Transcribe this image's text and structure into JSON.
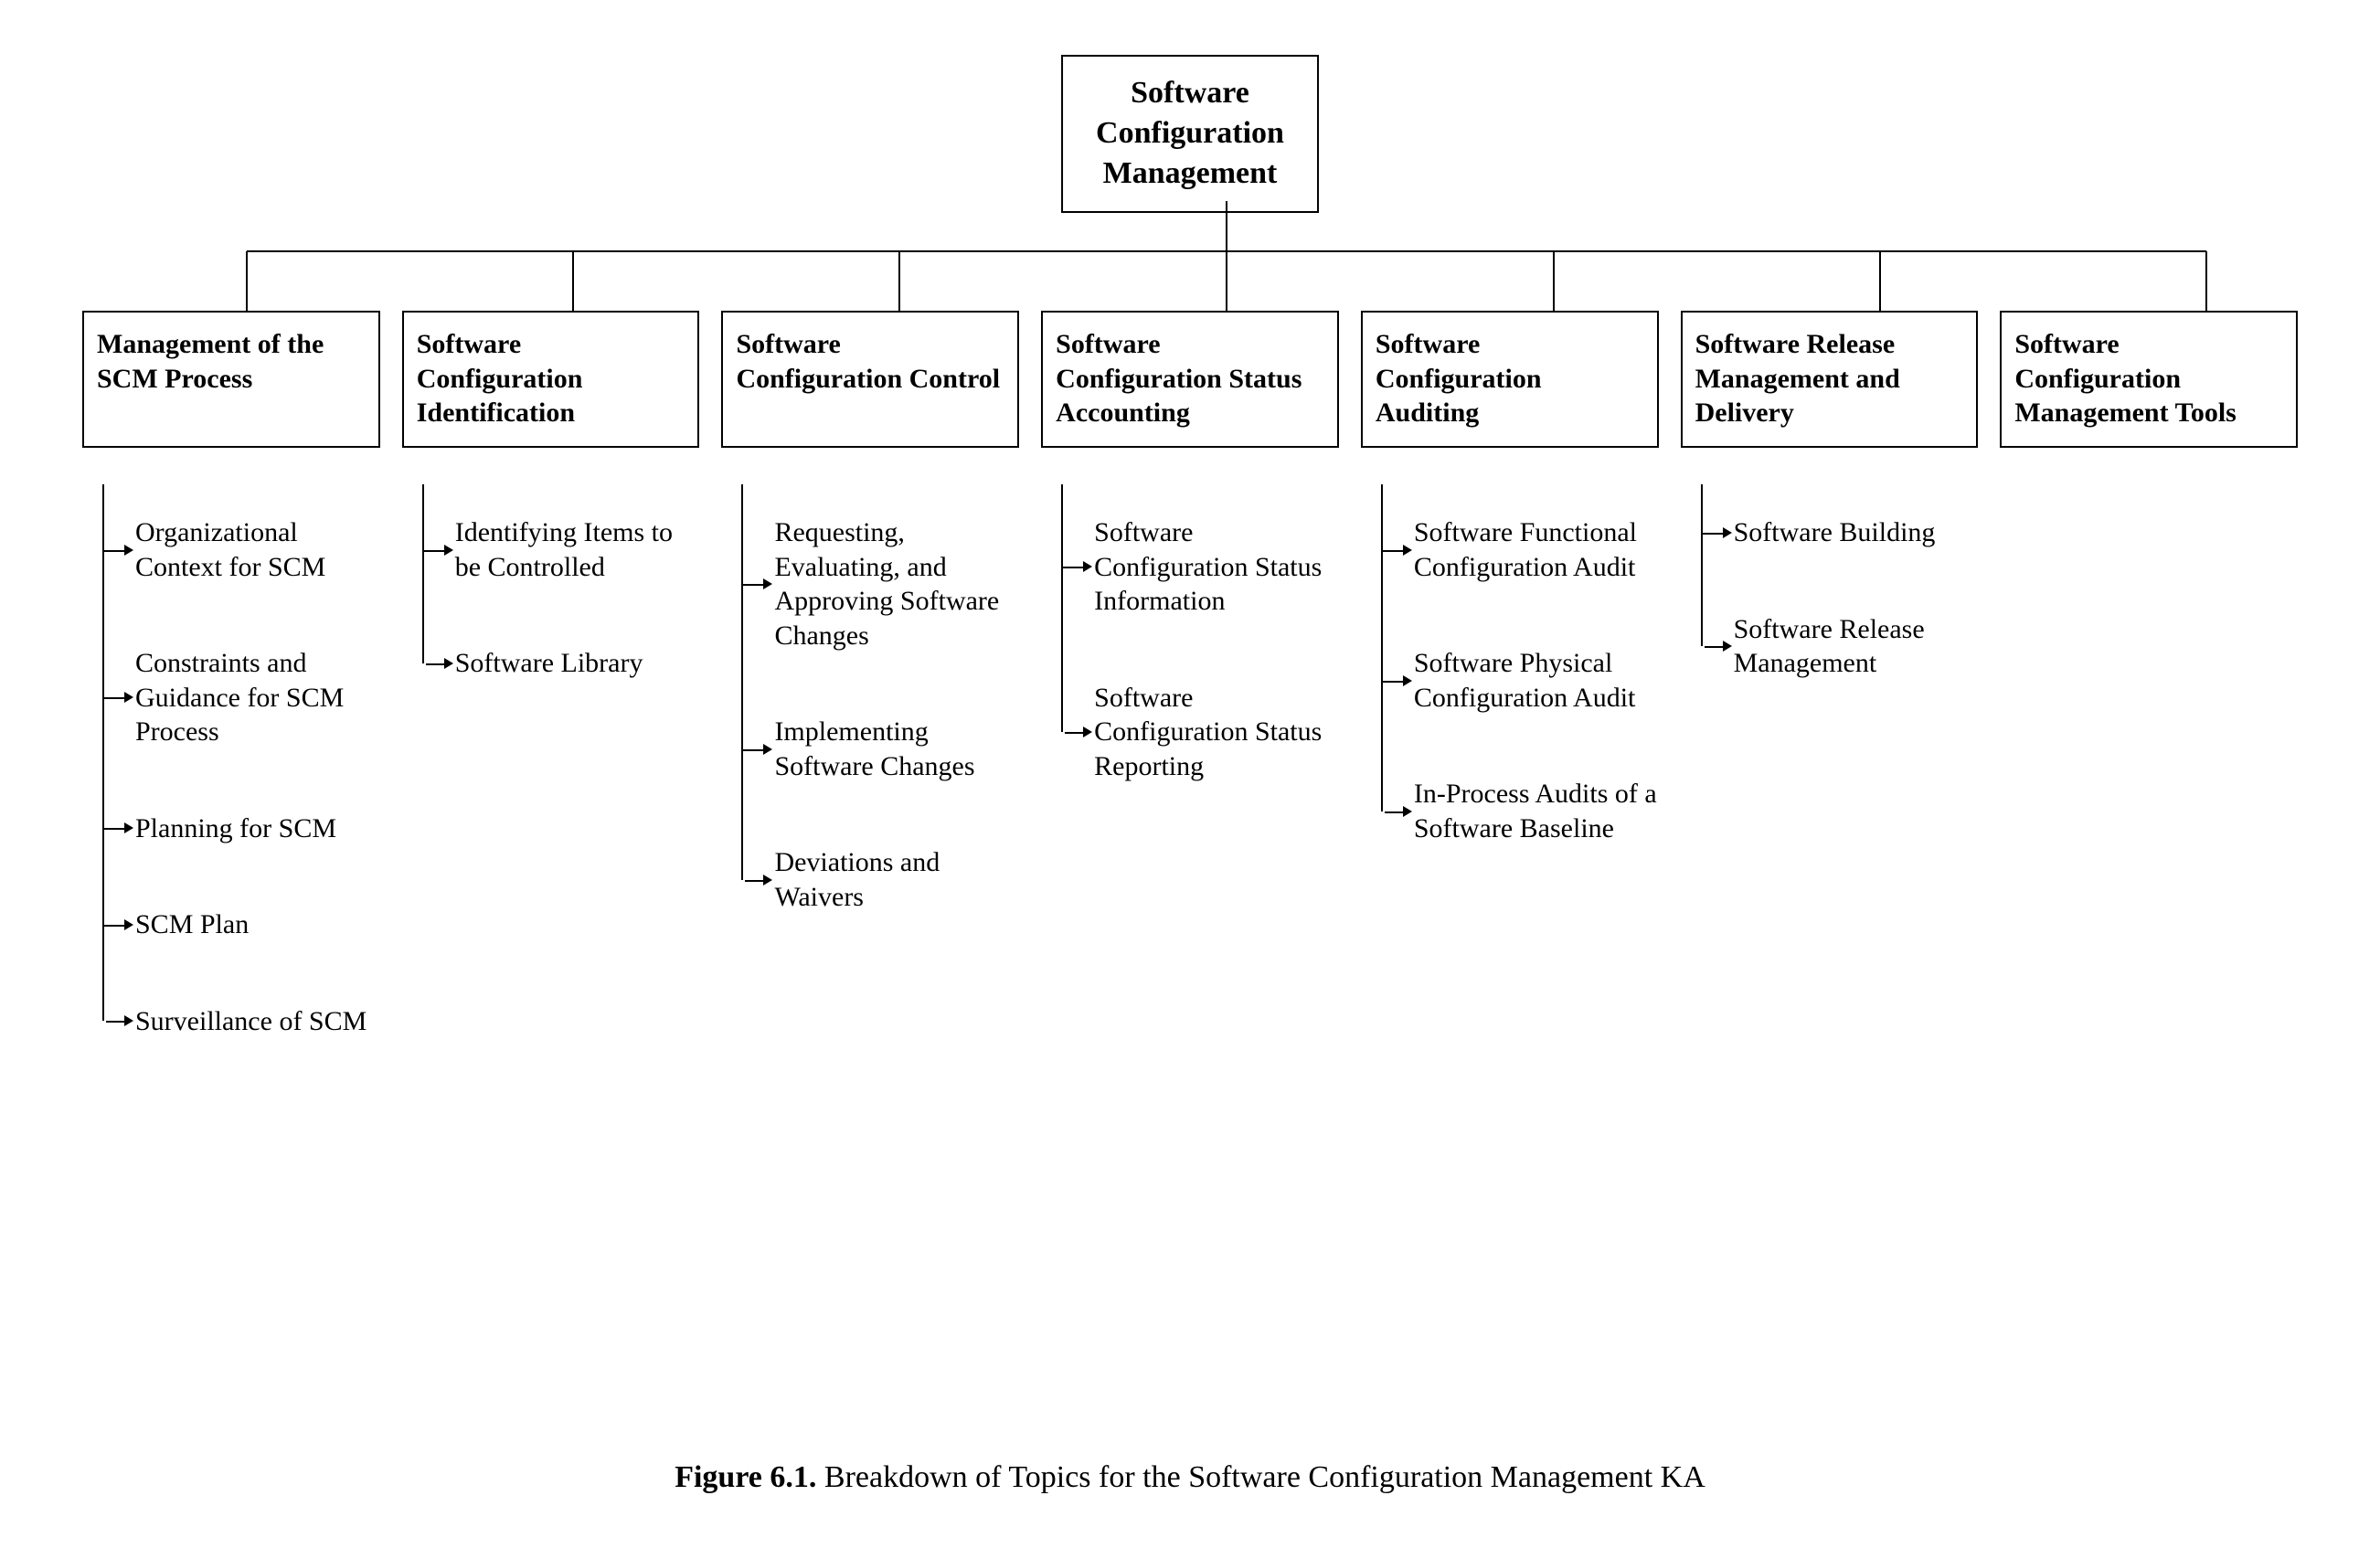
{
  "root": "Software\nConfiguration\nManagement",
  "branches": [
    {
      "label": "Management of the SCM Process",
      "subtopics": [
        "Organizational Context for SCM",
        "Constraints and Guidance for SCM Process",
        "Planning for SCM",
        "SCM Plan",
        "Surveillance of SCM"
      ]
    },
    {
      "label": "Software Configuration Identification",
      "subtopics": [
        "Identifying Items to be Controlled",
        "Software Library"
      ]
    },
    {
      "label": "Software Configuration Control",
      "subtopics": [
        "Requesting, Evaluating, and Approving Software Changes",
        "Implementing Software Changes",
        "Deviations and Waivers"
      ]
    },
    {
      "label": "Software Configuration Status Accounting",
      "subtopics": [
        "Software Configuration Status Information",
        "Software Configuration Status Reporting"
      ]
    },
    {
      "label": "Software Configuration Auditing",
      "subtopics": [
        "Software Functional Configuration Audit",
        "Software Physical Configuration Audit",
        "In-Process Audits of a Software Baseline"
      ]
    },
    {
      "label": "Software Release Management and Delivery",
      "subtopics": [
        "Software Building",
        "Software Release Management"
      ]
    },
    {
      "label": "Software Configuration Management Tools",
      "subtopics": []
    }
  ],
  "caption_label": "Figure 6.1.",
  "caption_text": " Breakdown of Topics for the Software Configuration Management KA"
}
